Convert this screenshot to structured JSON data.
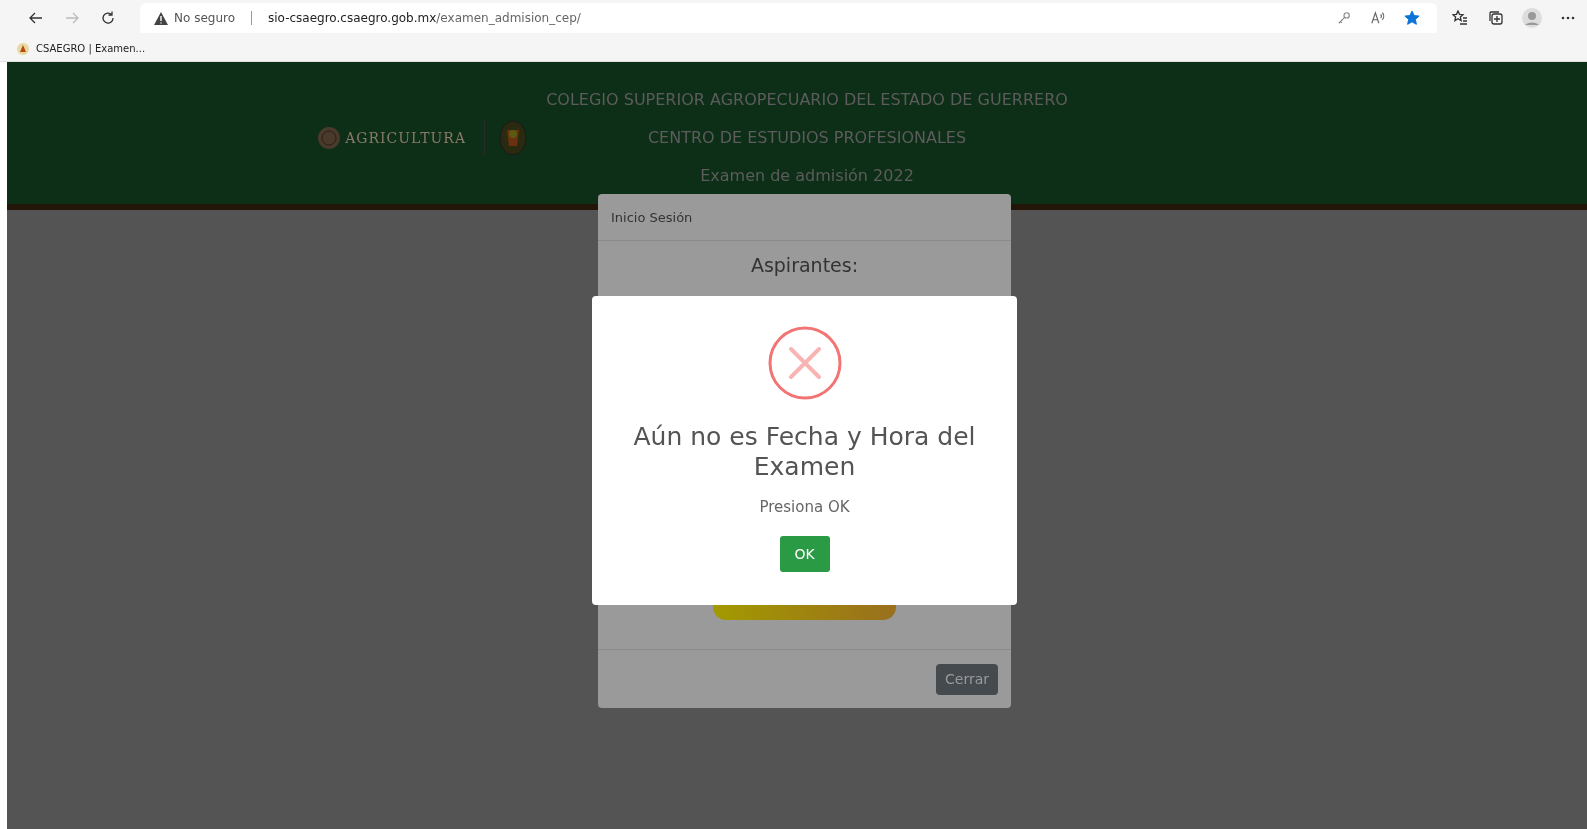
{
  "browser": {
    "security_label": "No seguro",
    "url_host": "sio-csaegro.csaegro.gob.mx",
    "url_path": "/examen_admision_cep/",
    "favorite": true
  },
  "bookmarks": [
    {
      "label": "CSAEGRO | Examen..."
    }
  ],
  "header": {
    "logo_text": "AGRICULTURA",
    "lines": [
      "COLEGIO SUPERIOR AGROPECUARIO DEL ESTADO DE GUERRERO",
      "CENTRO DE ESTUDIOS PROFESIONALES",
      "Examen de admisión 2022"
    ]
  },
  "login_modal": {
    "title": "Inicio Sesión",
    "heading": "Aspirantes:",
    "close_button": "Cerrar"
  },
  "alert": {
    "kind": "error",
    "title": "Aún no es Fecha y Hora del Examen",
    "message": "Presiona OK",
    "confirm_button": "OK"
  }
}
